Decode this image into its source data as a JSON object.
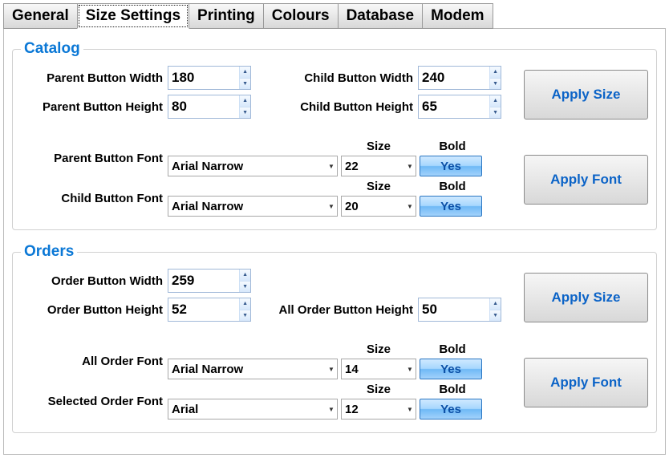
{
  "tabs": {
    "general": "General",
    "size_settings": "Size Settings",
    "printing": "Printing",
    "colours": "Colours",
    "database": "Database",
    "modem": "Modem"
  },
  "labels": {
    "size": "Size",
    "bold": "Bold",
    "yes": "Yes",
    "apply_size": "Apply Size",
    "apply_font": "Apply Font"
  },
  "catalog": {
    "legend": "Catalog",
    "parent_button_width_label": "Parent Button Width",
    "parent_button_width": "180",
    "parent_button_height_label": "Parent Button Height",
    "parent_button_height": "80",
    "child_button_width_label": "Child Button Width",
    "child_button_width": "240",
    "child_button_height_label": "Child Button Height",
    "child_button_height": "65",
    "parent_button_font_label": "Parent Button Font",
    "parent_button_font": "Arial Narrow",
    "parent_button_font_size": "22",
    "child_button_font_label": "Child Button Font",
    "child_button_font": "Arial Narrow",
    "child_button_font_size": "20"
  },
  "orders": {
    "legend": "Orders",
    "order_button_width_label": "Order Button Width",
    "order_button_width": "259",
    "order_button_height_label": "Order Button Height",
    "order_button_height": "52",
    "all_order_button_height_label": "All Order Button Height",
    "all_order_button_height": "50",
    "all_order_font_label": "All Order Font",
    "all_order_font": "Arial Narrow",
    "all_order_font_size": "14",
    "selected_order_font_label": "Selected Order Font",
    "selected_order_font": "Arial",
    "selected_order_font_size": "12"
  }
}
